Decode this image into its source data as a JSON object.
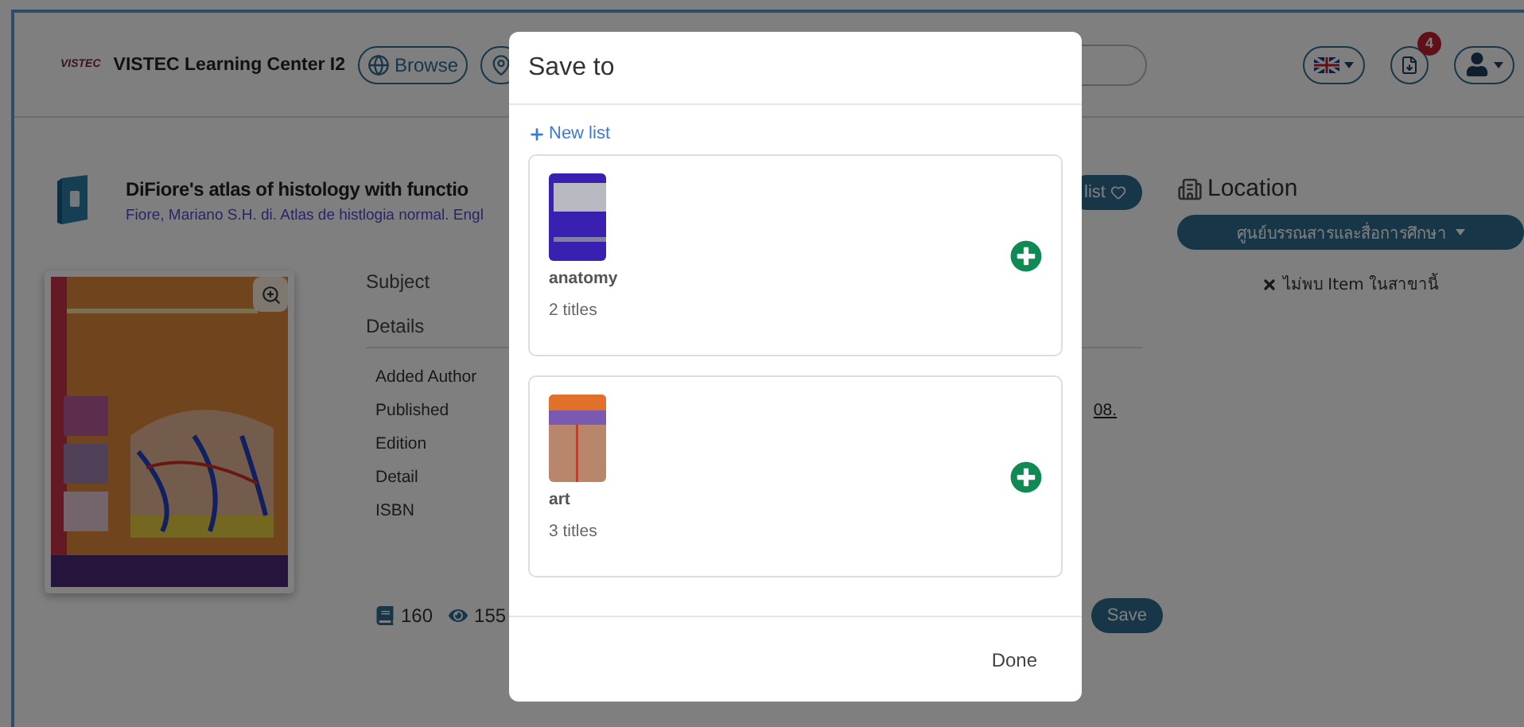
{
  "header": {
    "logo": "VISTEC",
    "site_name": "VISTEC Learning Center I2",
    "nav": [
      "Browse"
    ],
    "notification_count": "4"
  },
  "book": {
    "title": "DiFiore's atlas of histology with functio",
    "subtitle": "Fiore, Mariano S.H. di. Atlas de histlogia normal. Engl",
    "list_button": "list",
    "sections": [
      "Subject",
      "Details"
    ],
    "detail_labels": [
      "Added Author",
      "Published",
      "Edition",
      "Detail",
      "ISBN"
    ],
    "published_value": "08.",
    "loans": "160",
    "views": "155",
    "save_button": "Save"
  },
  "location": {
    "title": "Location",
    "branch": "ศูนย์บรรณสารและสื่อการศึกษา",
    "message": "ไม่พบ Item ในสาขานี้"
  },
  "dialog": {
    "title": "Save to",
    "new_list": "New list",
    "lists": [
      {
        "name": "anatomy",
        "count": "2 titles"
      },
      {
        "name": "art",
        "count": "3 titles"
      }
    ],
    "done": "Done"
  }
}
